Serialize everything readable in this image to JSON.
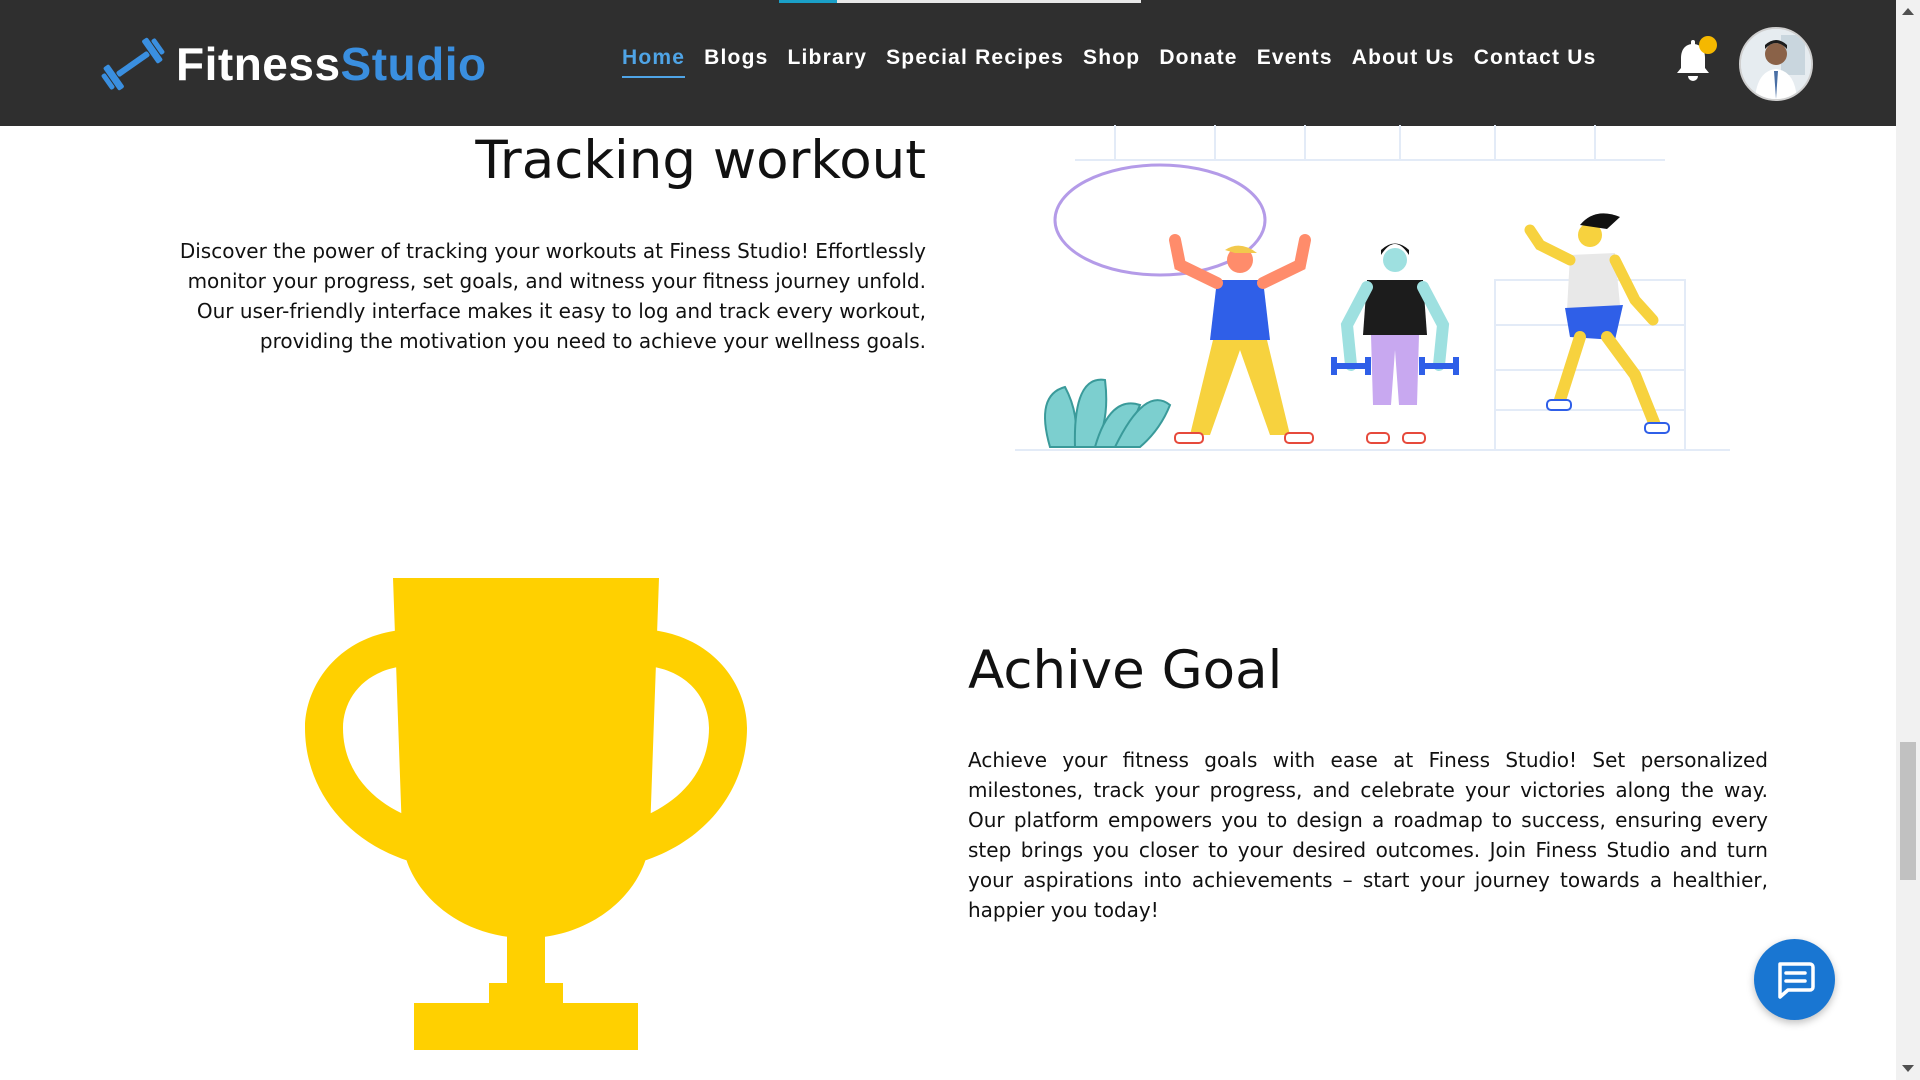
{
  "brand": {
    "part1": "Fitness",
    "part2": "Studio"
  },
  "nav": {
    "items": [
      {
        "label": "Home",
        "active": true
      },
      {
        "label": "Blogs",
        "active": false
      },
      {
        "label": "Library",
        "active": false
      },
      {
        "label": "Special Recipes",
        "active": false
      },
      {
        "label": "Shop",
        "active": false
      },
      {
        "label": "Donate",
        "active": false
      },
      {
        "label": "Events",
        "active": false
      },
      {
        "label": "About Us",
        "active": false
      },
      {
        "label": "Contact Us",
        "active": false
      }
    ],
    "notification_icon": "bell-icon",
    "avatar_icon": "user-avatar"
  },
  "sections": {
    "tracking": {
      "title": "Tracking workout",
      "text": "Discover the power of tracking your workouts at Finess Studio! Effortlessly monitor your progress, set goals, and witness your fitness journey unfold. Our user-friendly interface makes it easy to log and track every workout, providing the motivation you need to achieve your wellness goals."
    },
    "goal": {
      "title": "Achive Goal",
      "text": "Achieve your fitness goals with ease at Finess Studio! Set personalized milestones, track your progress, and celebrate your victories along the way. Our platform empowers you to design a roadmap to success, ensuring every step brings you closer to your desired outcomes. Join Finess Studio and turn your aspirations into achievements – start your journey towards a healthier, happier you today!"
    }
  },
  "colors": {
    "navbar_bg": "#2f2f2f",
    "brand_accent": "#3a8fe0",
    "active_link": "#4fa4e6",
    "trophy": "#ffd000",
    "chat_fab": "#1976d2",
    "notification_dot": "#f5b800"
  },
  "icons": {
    "brand": "dumbbell-icon",
    "chat": "chat-icon",
    "trophy": "trophy-icon"
  }
}
